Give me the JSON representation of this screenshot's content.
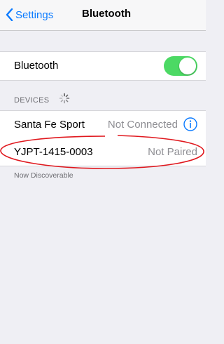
{
  "navbar": {
    "back_label": "Settings",
    "title": "Bluetooth"
  },
  "bluetooth_row": {
    "label": "Bluetooth",
    "toggle_on": true
  },
  "devices_section": {
    "header": "DEVICES",
    "items": [
      {
        "name": "Santa Fe Sport",
        "status": "Not Connected"
      },
      {
        "name": "YJPT-1415-0003",
        "status": "Not Paired"
      }
    ]
  },
  "footer": "Now Discoverable",
  "colors": {
    "accent": "#0a7aff",
    "toggle_on": "#4cd964",
    "annotation": "#e0181e"
  }
}
